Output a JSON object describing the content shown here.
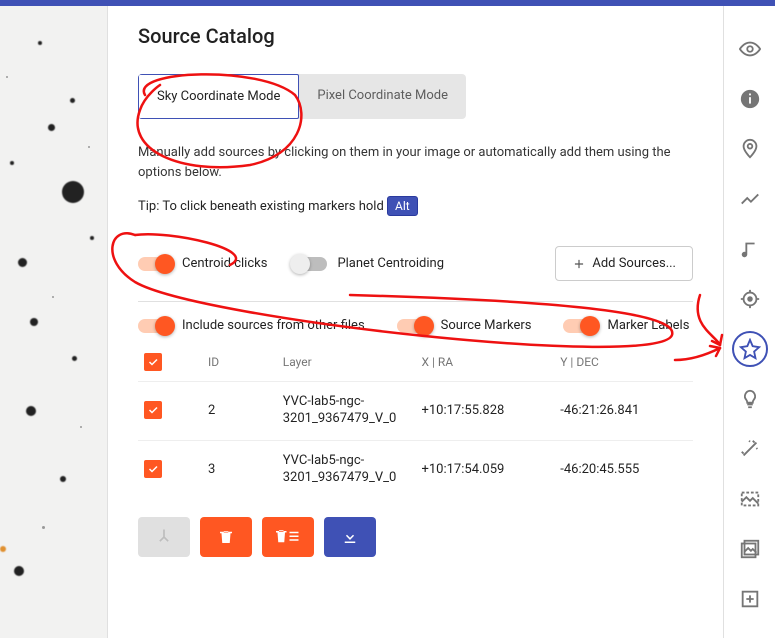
{
  "title": "Source Catalog",
  "modes": {
    "sky": "Sky Coordinate Mode",
    "pixel": "Pixel Coordinate Mode"
  },
  "helper_text": "Manually add sources by clicking on them in your image or automatically add them using the options below.",
  "tip_prefix": "Tip: To click beneath existing markers hold",
  "tip_key": "Alt",
  "toggles": {
    "centroid_clicks": "Centroid clicks",
    "planet_centroiding": "Planet Centroiding",
    "include_other": "Include sources from other files",
    "source_markers": "Source Markers",
    "marker_labels": "Marker Labels"
  },
  "add_sources_label": "Add Sources...",
  "columns": {
    "id": "ID",
    "layer": "Layer",
    "x_ra": "X | RA",
    "y_dec": "Y | DEC"
  },
  "rows": [
    {
      "id": "2",
      "layer": "YVC-lab5-ngc-3201_9367479_V_0",
      "ra": "+10:17:55.828",
      "dec": "-46:21:26.841"
    },
    {
      "id": "3",
      "layer": "YVC-lab5-ngc-3201_9367479_V_0",
      "ra": "+10:17:54.059",
      "dec": "-46:20:45.555"
    }
  ],
  "rail": {
    "visibility": "visibility-icon",
    "info": "info-icon",
    "place": "place-icon",
    "trend": "trend-icon",
    "note": "music-note-icon",
    "target": "target-icon",
    "star": "star-icon",
    "bulb": "bulb-icon",
    "wand": "wand-icon",
    "image": "image-icon",
    "collection": "collection-icon",
    "add": "add-box-icon"
  }
}
